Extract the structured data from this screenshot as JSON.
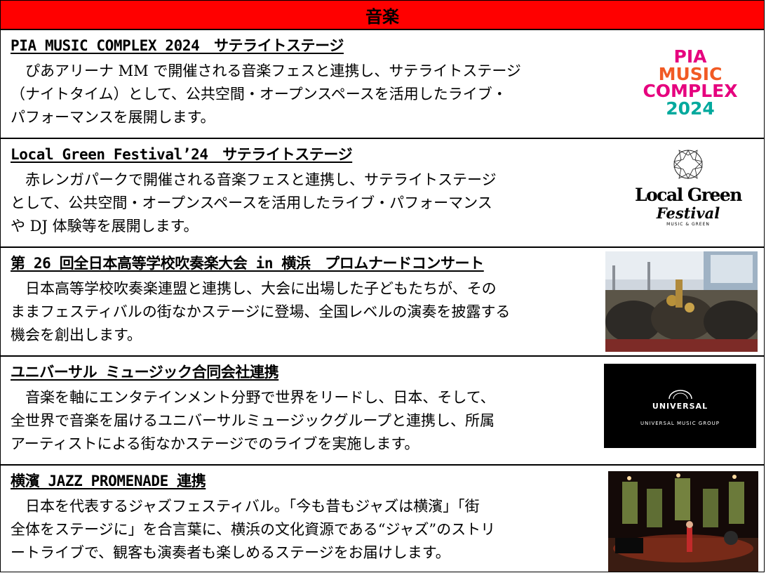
{
  "header": {
    "title": "音楽"
  },
  "sections": [
    {
      "title": "PIA MUSIC COMPLEX 2024　サテライトステージ",
      "lines": [
        "　ぴあアリーナ MM で開催される音楽フェスと連携し、サテライトステージ",
        "（ナイトタイム）として、公共空間・オープンスペースを活用したライブ・",
        "パフォーマンスを展開します。"
      ],
      "logo": {
        "line1": "PIA",
        "line2": "MUSIC",
        "line3": "COMPLEX",
        "line4": "2024"
      }
    },
    {
      "title": "Local Green Festival’24　サテライトステージ",
      "lines": [
        "　赤レンガパークで開催される音楽フェスと連携し、サテライトステージ",
        "として、公共空間・オープンスペースを活用したライブ・パフォーマンス",
        "や DJ 体験等を展開します。"
      ],
      "logo": {
        "word1": "Local Green",
        "word2": "Festival",
        "tag": "MUSIC & GREEN"
      }
    },
    {
      "title": "第 26 回全日本高等学校吹奏楽大会 in 横浜　プロムナードコンサート",
      "lines": [
        "　日本高等学校吹奏楽連盟と連携し、大会に出場した子どもたちが、その",
        "ままフェスティバルの街なかステージに登場、全国レベルの演奏を披露する",
        "機会を創出します。"
      ]
    },
    {
      "title": "ユニバーサル ミュージック合同会社連携",
      "lines": [
        "　音楽を軸にエンタテインメント分野で世界をリードし、日本、そして、",
        "全世界で音楽を届けるユニバーサルミュージックグループと連携し、所属",
        "アーティストによる街なかステージでのライブを実施します。"
      ],
      "logo": {
        "brand": "UNIVERSAL",
        "sub": "UNIVERSAL MUSIC GROUP"
      }
    },
    {
      "title": "横濱 JAZZ PROMENADE 連携",
      "lines": [
        "　日本を代表するジャズフェスティバル。「今も昔もジャズは横濱」「街",
        "全体をステージに」を合言葉に、横浜の文化資源である“ジャズ”のストリ",
        "ートライブで、観客も演奏者も楽しめるステージをお届けします。"
      ]
    }
  ],
  "colors": {
    "header_bg": "#ff0000",
    "pia_magenta": "#e6007e",
    "pia_orange": "#f15a24",
    "pia_teal": "#00a99d",
    "pia_blue": "#2e3192"
  }
}
